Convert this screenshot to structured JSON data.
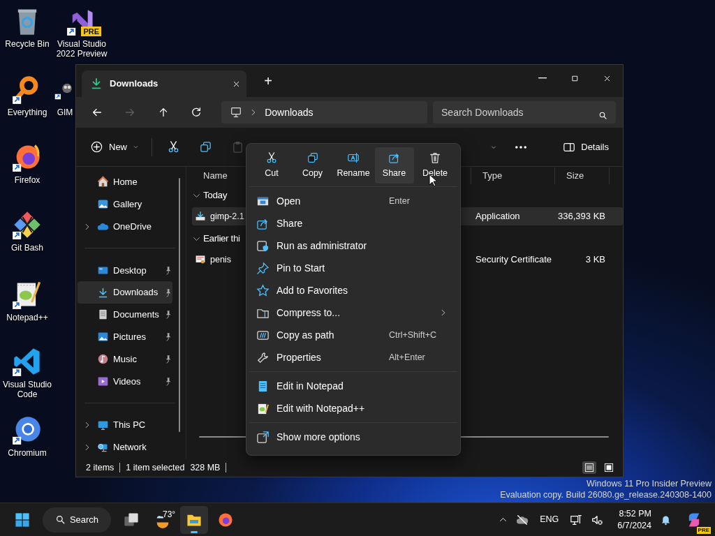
{
  "desktop": {
    "shortcuts": [
      {
        "label": "Recycle Bin",
        "kind": "recycle",
        "shortcut": false
      },
      {
        "label": "Everything",
        "kind": "everything",
        "shortcut": true
      },
      {
        "label": "Firefox",
        "kind": "firefox",
        "shortcut": true
      },
      {
        "label": "Git Bash",
        "kind": "gitbash",
        "shortcut": true
      },
      {
        "label": "Notepad++",
        "kind": "notepadpp",
        "shortcut": true
      },
      {
        "label": "Visual Studio Code",
        "kind": "vscode",
        "shortcut": true
      },
      {
        "label": "Chromium",
        "kind": "chromium",
        "shortcut": true
      },
      {
        "label": "Visual Studio 2022 Preview",
        "kind": "vs",
        "shortcut": true,
        "badge": "PRE"
      },
      {
        "label": "GIM",
        "kind": "gimp",
        "shortcut": true
      }
    ],
    "build_info": [
      "Windows 11 Pro Insider Preview",
      "Evaluation copy. Build 26080.ge_release.240308-1400"
    ]
  },
  "explorer": {
    "tabs": [
      {
        "label": "Downloads",
        "selected": true
      }
    ],
    "new_tab": "+",
    "nav": [
      {
        "kind": "back",
        "disabled": false
      },
      {
        "kind": "forward",
        "disabled": true
      },
      {
        "kind": "up",
        "disabled": false
      },
      {
        "kind": "refresh",
        "disabled": false
      }
    ],
    "breadcrumb": [
      "Downloads"
    ],
    "search": {
      "placeholder": "Search Downloads"
    },
    "toolbar": [
      {
        "kind": "new",
        "label": "New",
        "disabled": false
      },
      {
        "kind": "cut",
        "disabled": false
      },
      {
        "kind": "copy",
        "disabled": false
      },
      {
        "kind": "paste",
        "disabled": true
      }
    ],
    "details_button": "Details",
    "sidebar": [
      [
        {
          "label": "Home",
          "kind": "home",
          "expandable": false,
          "pinned": false,
          "selected": false
        },
        {
          "label": "Gallery",
          "kind": "gallery",
          "expandable": false,
          "pinned": false,
          "selected": false
        },
        {
          "label": "OneDrive",
          "kind": "cloud",
          "expandable": true,
          "pinned": false,
          "selected": false
        }
      ],
      [
        {
          "label": "Desktop",
          "kind": "desktop",
          "expandable": false,
          "pinned": true,
          "selected": false
        },
        {
          "label": "Downloads",
          "kind": "downloads",
          "expandable": false,
          "pinned": true,
          "selected": true
        },
        {
          "label": "Documents",
          "kind": "documents",
          "expandable": false,
          "pinned": true,
          "selected": false
        },
        {
          "label": "Pictures",
          "kind": "pictures",
          "expandable": false,
          "pinned": true,
          "selected": false
        },
        {
          "label": "Music",
          "kind": "music",
          "expandable": false,
          "pinned": true,
          "selected": false
        },
        {
          "label": "Videos",
          "kind": "videos",
          "expandable": false,
          "pinned": true,
          "selected": false
        }
      ],
      [
        {
          "label": "This PC",
          "kind": "pc",
          "expandable": true,
          "pinned": false,
          "selected": false
        },
        {
          "label": "Network",
          "kind": "network",
          "expandable": true,
          "pinned": false,
          "selected": false
        }
      ]
    ],
    "columns": [
      "Name",
      "Type",
      "Size"
    ],
    "groups": [
      {
        "label": "Today",
        "expanded": true,
        "rows": [
          {
            "name": "gimp-2.1",
            "kind": "installer",
            "type": "Application",
            "size": "336,393 KB",
            "selected": true
          }
        ]
      },
      {
        "label": "Earlier thi",
        "expanded": true,
        "rows": [
          {
            "name": "penis",
            "kind": "certificate",
            "type": "Security Certificate",
            "size": "3 KB",
            "selected": false
          }
        ]
      }
    ],
    "status": {
      "count": "2 items",
      "selection": "1 item selected",
      "size": "328 MB"
    },
    "view_modes": [
      {
        "kind": "details",
        "selected": true
      },
      {
        "kind": "tiles",
        "selected": false
      }
    ]
  },
  "context_menu": {
    "actions": [
      {
        "label": "Cut",
        "kind": "cut",
        "selected": false
      },
      {
        "label": "Copy",
        "kind": "copy",
        "selected": false
      },
      {
        "label": "Rename",
        "kind": "rename",
        "selected": false
      },
      {
        "label": "Share",
        "kind": "share",
        "selected": true
      },
      {
        "label": "Delete",
        "kind": "delete",
        "selected": false
      }
    ],
    "sections": [
      [
        {
          "label": "Open",
          "kind": "open",
          "shortcut": "Enter",
          "submenu": false
        },
        {
          "label": "Share",
          "kind": "share",
          "submenu": false
        },
        {
          "label": "Run as administrator",
          "kind": "admin",
          "submenu": false
        },
        {
          "label": "Pin to Start",
          "kind": "pin",
          "submenu": false
        },
        {
          "label": "Add to Favorites",
          "kind": "star",
          "submenu": false
        },
        {
          "label": "Compress to...",
          "kind": "zip",
          "submenu": true
        },
        {
          "label": "Copy as path",
          "kind": "path",
          "shortcut": "Ctrl+Shift+C",
          "submenu": false
        },
        {
          "label": "Properties",
          "kind": "wrench",
          "shortcut": "Alt+Enter",
          "submenu": false
        }
      ],
      [
        {
          "label": "Edit in Notepad",
          "kind": "notepad",
          "submenu": false
        },
        {
          "label": "Edit with Notepad++",
          "kind": "notepadpp",
          "submenu": false
        }
      ],
      [
        {
          "label": "Show more options",
          "kind": "more",
          "submenu": false
        }
      ]
    ]
  },
  "taskbar": {
    "items": [
      {
        "kind": "start",
        "active": false
      },
      {
        "kind": "search",
        "label": "Search",
        "active": false
      },
      {
        "kind": "taskview",
        "active": false
      },
      {
        "kind": "weather",
        "label": "73°",
        "active": false
      },
      {
        "kind": "explorer",
        "active": true
      },
      {
        "kind": "firefox",
        "active": false
      }
    ],
    "tray": {
      "language": "ENG",
      "time": "8:52 PM",
      "date": "6/7/2024",
      "copilot_badge": "PRE"
    }
  }
}
